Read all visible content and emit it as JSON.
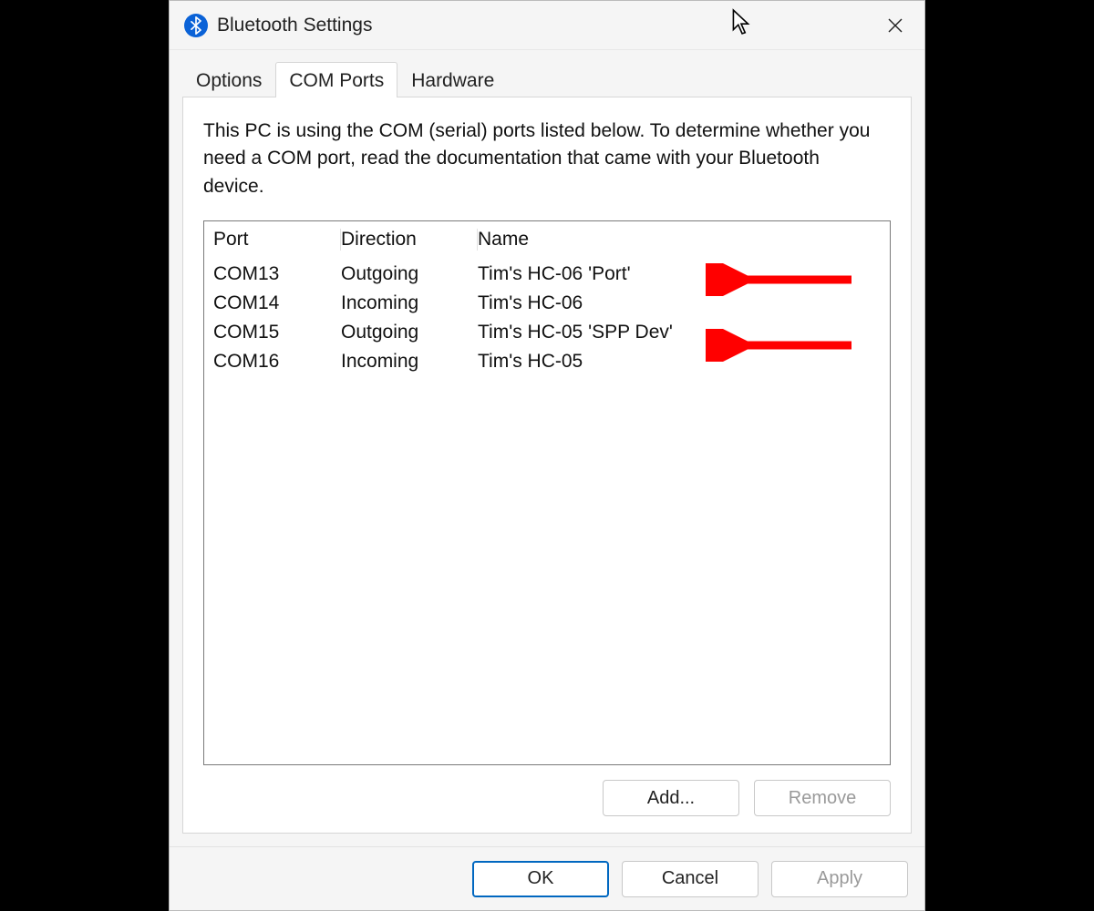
{
  "window": {
    "title": "Bluetooth Settings"
  },
  "tabs": {
    "items": [
      {
        "label": "Options"
      },
      {
        "label": "COM Ports"
      },
      {
        "label": "Hardware"
      }
    ],
    "active_index": 1
  },
  "panel": {
    "description": "This PC is using the COM (serial) ports listed below. To determine whether you need a COM port, read the documentation that came with your Bluetooth device.",
    "columns": {
      "port": "Port",
      "direction": "Direction",
      "name": "Name"
    },
    "rows": [
      {
        "port": "COM13",
        "direction": "Outgoing",
        "name": "Tim's HC-06 'Port'",
        "arrow": true
      },
      {
        "port": "COM14",
        "direction": "Incoming",
        "name": "Tim's HC-06",
        "arrow": false
      },
      {
        "port": "COM15",
        "direction": "Outgoing",
        "name": "Tim's HC-05 'SPP Dev'",
        "arrow": true
      },
      {
        "port": "COM16",
        "direction": "Incoming",
        "name": "Tim's HC-05",
        "arrow": false
      }
    ],
    "buttons": {
      "add": "Add...",
      "remove": "Remove"
    }
  },
  "dialog_buttons": {
    "ok": "OK",
    "cancel": "Cancel",
    "apply": "Apply"
  },
  "annotation": {
    "color": "#ff0000"
  }
}
